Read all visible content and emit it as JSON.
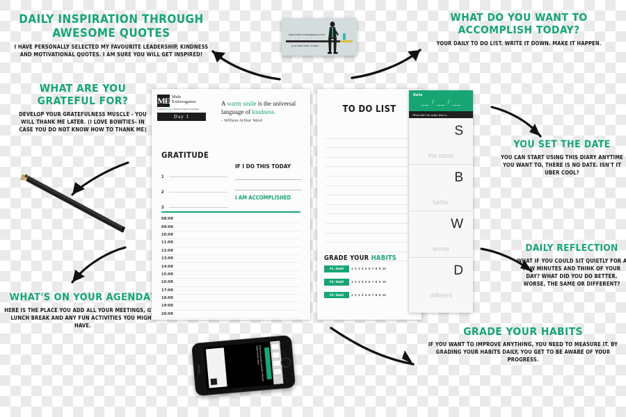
{
  "annotations": {
    "quotes": {
      "heading": "Daily inspiration through awesome quotes",
      "body": "I have personally selected my favourite leadership, kindness and motivational quotes. I am sure you will get inspired!"
    },
    "accomplish": {
      "heading": "What do you want to accomplish today?",
      "body": "Your daily to do list. Write it down. Make it happen."
    },
    "grateful": {
      "heading": "What are you grateful for?",
      "body": "Develop your gratefulness muscle - you will thank me later. (I love bowties- in case you do not know how to thank me)"
    },
    "setdate": {
      "heading": "You set the date",
      "body": "You can start using this diary anytime you want to, there is no date. Isn't it uber cool?"
    },
    "reflection": {
      "heading": "Daily reflection",
      "body": "What if you could sit quietly for a few minutes and think of your day? What did you do better, worse, the same or different?"
    },
    "agenda": {
      "heading": "What's on your agenda?",
      "body": "Here is the place you add all your meetings, gym, lunch break and any fun activities you might have."
    },
    "habits": {
      "heading": "Grade your habits",
      "body": "If you want to improve anything, you need to measure it. By grading your habits daily, you get to be aware of your progress."
    }
  },
  "gratitude_page": {
    "logo": {
      "mark": "ME",
      "line1": "Male",
      "line2": "Extravaganza",
      "tagline_pre": "Creating ",
      "tagline_em": "Happy",
      "tagline_post": ", Kind & Stylish Gentlemen"
    },
    "day_badge": "Day 1",
    "quote": {
      "pre": "A ",
      "green1": "warm smile",
      "mid": " is the universal language of ",
      "green2": "kindness.",
      "attribution": "- William Arthur Ward"
    },
    "section_title": "Gratitude",
    "gratitude_numbers": [
      "1",
      "2",
      "3"
    ],
    "if_box": {
      "heading": "If I do this today",
      "accomplished": "I am accomplished"
    },
    "schedule": [
      "08:00",
      "09:00",
      "10:00",
      "11:00",
      "12:00",
      "13:00",
      "14:00",
      "15:00",
      "16:00",
      "17:00",
      "18:00",
      "19:00",
      "20:00"
    ]
  },
  "todo_page": {
    "title": "To Do List",
    "line_count": 14,
    "habits_title_pre": "Grade your ",
    "habits_title_green": "Habits",
    "habits": [
      {
        "label": "#1. Habit",
        "scale": [
          "1",
          "2",
          "3",
          "4",
          "5",
          "6",
          "7",
          "8",
          "9",
          "10"
        ]
      },
      {
        "label": "#2. Habit",
        "scale": [
          "1",
          "2",
          "3",
          "4",
          "5",
          "6",
          "7",
          "8",
          "9",
          "10"
        ]
      },
      {
        "label": "#3. Habit",
        "scale": [
          "1",
          "2",
          "3",
          "4",
          "5",
          "6",
          "7",
          "8",
          "9",
          "10"
        ]
      }
    ]
  },
  "date_card": {
    "date_label": "Date",
    "date_slots": "__ / __ / __",
    "subheading": "What did I do today that is...",
    "rows": [
      {
        "letter": "S",
        "word": "the same"
      },
      {
        "letter": "B",
        "word": "better"
      },
      {
        "letter": "W",
        "word": "worse"
      },
      {
        "letter": "D",
        "word": "different"
      }
    ]
  },
  "business_card": {
    "url": "www.male-extravaganza.com",
    "tagline": "your daily touch of class"
  },
  "colors": {
    "accent_green": "#17a673",
    "ink": "#1a1a1a",
    "paper": "#fcfcfc"
  }
}
